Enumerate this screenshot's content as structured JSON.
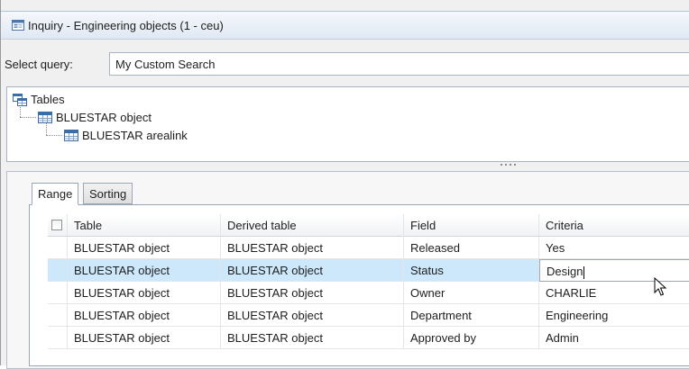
{
  "window": {
    "title": "Inquiry - Engineering objects (1 - ceu)",
    "icon": "form-window-icon"
  },
  "query": {
    "label": "Select query:",
    "value": "My Custom Search"
  },
  "tree": {
    "root": {
      "label": "Tables",
      "icon": "tables-icon"
    },
    "children": [
      {
        "label": "BLUESTAR object",
        "icon": "table-grid-icon"
      },
      {
        "label": "BLUESTAR arealink",
        "icon": "table-grid-icon"
      }
    ]
  },
  "tabs": [
    {
      "label": "Range",
      "active": true
    },
    {
      "label": "Sorting",
      "active": false
    }
  ],
  "grid": {
    "columns": [
      "Table",
      "Derived table",
      "Field",
      "Criteria"
    ],
    "rows": [
      [
        "BLUESTAR object",
        "BLUESTAR object",
        "Released",
        "Yes"
      ],
      [
        "BLUESTAR object",
        "BLUESTAR object",
        "Status",
        "Design"
      ],
      [
        "BLUESTAR object",
        "BLUESTAR object",
        "Owner",
        "CHARLIE"
      ],
      [
        "BLUESTAR object",
        "BLUESTAR object",
        "Department",
        "Engineering"
      ],
      [
        "BLUESTAR object",
        "BLUESTAR object",
        "Approved by",
        "Admin"
      ]
    ],
    "selected_row": 1
  },
  "colors": {
    "selection": "#cde8fb",
    "border": "#a8b4c2",
    "titlebar": "#dfe8f3"
  }
}
